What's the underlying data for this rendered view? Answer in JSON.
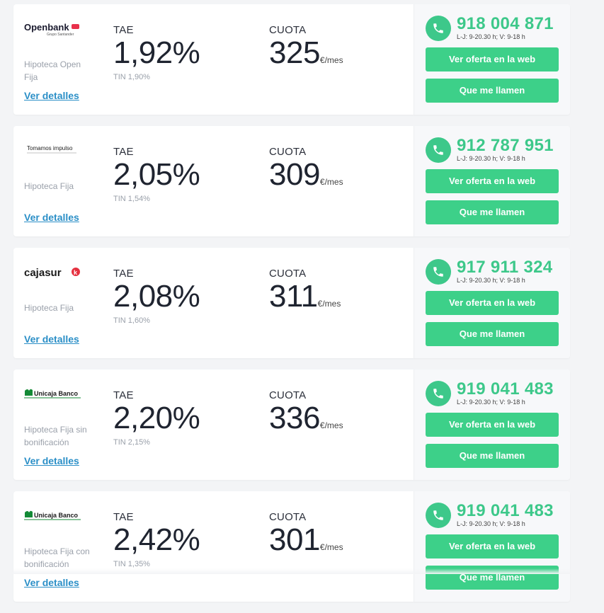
{
  "offers": [
    {
      "bank": "Openbank",
      "bank_sub": "Grupo Santander",
      "logo": "openbank",
      "product": "Hipoteca Open Fija",
      "details_label": "Ver detalles",
      "tae_label": "TAE",
      "tae": "1,92%",
      "tin": "TIN 1,90%",
      "cuota_label": "CUOTA",
      "cuota": "325",
      "cuota_unit": "€/mes",
      "phone": "918 004 871",
      "hours": "L-J: 9-20.30 h; V: 9-18 h",
      "web_btn": "Ver oferta en la web",
      "call_btn": "Que me llamen"
    },
    {
      "bank": "Tomamos impulso",
      "logo": "impulso",
      "product": "Hipoteca Fija",
      "details_label": "Ver detalles",
      "tae_label": "TAE",
      "tae": "2,05%",
      "tin": "TIN 1,54%",
      "cuota_label": "CUOTA",
      "cuota": "309",
      "cuota_unit": "€/mes",
      "phone": "912 787 951",
      "hours": "L-J: 9-20.30 h; V: 9-18 h",
      "web_btn": "Ver oferta en la web",
      "call_btn": "Que me llamen"
    },
    {
      "bank": "cajasur",
      "logo": "cajasur",
      "product": "Hipoteca Fija",
      "details_label": "Ver detalles",
      "tae_label": "TAE",
      "tae": "2,08%",
      "tin": "TIN 1,60%",
      "cuota_label": "CUOTA",
      "cuota": "311",
      "cuota_unit": "€/mes",
      "phone": "917 911 324",
      "hours": "L-J: 9-20.30 h; V: 9-18 h",
      "web_btn": "Ver oferta en la web",
      "call_btn": "Que me llamen"
    },
    {
      "bank": "Unicaja Banco",
      "logo": "unicaja",
      "product": "Hipoteca Fija sin bonificación",
      "details_label": "Ver detalles",
      "tae_label": "TAE",
      "tae": "2,20%",
      "tin": "TIN 2,15%",
      "cuota_label": "CUOTA",
      "cuota": "336",
      "cuota_unit": "€/mes",
      "phone": "919 041 483",
      "hours": "L-J: 9-20.30 h; V: 9-18 h",
      "web_btn": "Ver oferta en la web",
      "call_btn": "Que me llamen"
    },
    {
      "bank": "Unicaja Banco",
      "logo": "unicaja",
      "product": "Hipoteca Fija con bonificación",
      "details_label": "Ver detalles",
      "tae_label": "TAE",
      "tae": "2,42%",
      "tin": "TIN 1,35%",
      "cuota_label": "CUOTA",
      "cuota": "301",
      "cuota_unit": "€/mes",
      "phone": "919 041 483",
      "hours": "L-J: 9-20.30 h; V: 9-18 h",
      "web_btn": "Ver oferta en la web",
      "call_btn": "Que me llamen"
    }
  ],
  "colors": {
    "accent_green": "#3dd089",
    "link_blue": "#2b8fc7",
    "openbank_red": "#e8314b",
    "cajasur_red": "#e5303f",
    "unicaja_green": "#138a36"
  }
}
